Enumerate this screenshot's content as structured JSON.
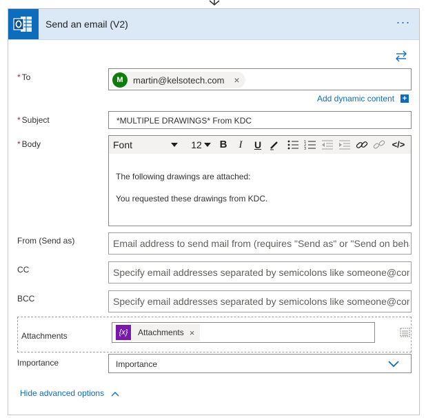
{
  "header": {
    "title": "Send an email (V2)",
    "more_label": "···"
  },
  "fields": {
    "to": {
      "label": "To",
      "required_mark": "*",
      "token_initial": "M",
      "token_email": "martin@kelsotech.com",
      "remove_icon": "×"
    },
    "dynamic_content": {
      "label": "Add dynamic content",
      "plus": "+"
    },
    "subject": {
      "label": "Subject",
      "required_mark": "*",
      "value": "*MULTIPLE DRAWINGS* From KDC"
    },
    "body": {
      "label": "Body",
      "required_mark": "*",
      "toolbar": {
        "font": "Font",
        "size": "12",
        "bold": "B",
        "italic": "I",
        "underline": "U",
        "code": "</>"
      },
      "lines": [
        "The following drawings are attached:",
        "You requested these drawings from KDC."
      ]
    },
    "from": {
      "label": "From (Send as)",
      "placeholder": "Email address to send mail from (requires \"Send as\" or \"Send on beha"
    },
    "cc": {
      "label": "CC",
      "placeholder": "Specify email addresses separated by semicolons like someone@contoso.com"
    },
    "bcc": {
      "label": "BCC",
      "placeholder": "Specify email addresses separated by semicolons like someone@contoso.com"
    },
    "attachments": {
      "label": "Attachments",
      "token_icon": "{x}",
      "token_label": "Attachments",
      "remove_icon": "×"
    },
    "importance": {
      "label": "Importance",
      "value": "Importance"
    }
  },
  "footer": {
    "hide_advanced": "Hide advanced options"
  },
  "colors": {
    "accent": "#0f6cbd",
    "header_bg": "#dbe8f6",
    "required": "#a4262c",
    "avatar": "#107c10",
    "expression": "#7719aa"
  }
}
